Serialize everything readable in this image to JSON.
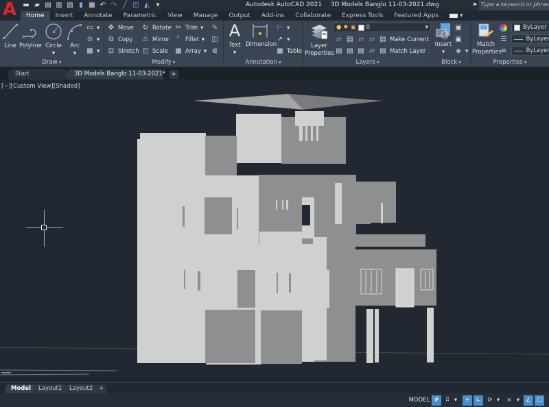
{
  "app": {
    "name": "Autodesk AutoCAD 2021",
    "file": "3D Models Banglo 11-03-2021.dwg",
    "search_placeholder": "Type a keyword or phrase",
    "accent": "#d8262b"
  },
  "qat": [
    "new-icon",
    "open-icon",
    "save-icon",
    "save-as-icon",
    "publish-icon",
    "share-icon",
    "plot-icon",
    "undo-icon",
    "redo-icon",
    "line-icon",
    "box-icon",
    "workspace-icon",
    "customize-icon"
  ],
  "ribbon_tabs": [
    "Home",
    "Insert",
    "Annotate",
    "Parametric",
    "View",
    "Manage",
    "Output",
    "Add-ins",
    "Collaborate",
    "Express Tools",
    "Featured Apps"
  ],
  "panels": {
    "draw": {
      "label": "Draw",
      "line": "Line",
      "polyline": "Polyline",
      "circle": "Circle",
      "arc": "Arc"
    },
    "modify": {
      "label": "Modify",
      "move": "Move",
      "rotate": "Rotate",
      "trim": "Trim",
      "copy": "Copy",
      "mirror": "Mirror",
      "fillet": "Fillet",
      "stretch": "Stretch",
      "scale": "Scale",
      "array": "Array"
    },
    "annotation": {
      "label": "Annotation",
      "text": "Text",
      "dimension": "Dimension",
      "table": "Table"
    },
    "layers": {
      "label": "Layers",
      "layer_properties_1": "Layer",
      "layer_properties_2": "Properties",
      "current_layer": "0",
      "make_current": "Make Current",
      "match_layer": "Match Layer"
    },
    "block": {
      "label": "Block",
      "insert": "Insert"
    },
    "properties": {
      "label": "Properties",
      "match_1": "Match",
      "match_2": "Properties",
      "color": "ByLayer",
      "linetype": "ByLayer",
      "lineweight": "ByLayer"
    }
  },
  "doc_tabs": {
    "start": "Start",
    "current": "3D Models Banglo 11-03-2021*",
    "close": "✕",
    "add": "+"
  },
  "viewport": {
    "label": "[−][Custom View][Shaded]"
  },
  "layout_tabs": [
    "Model",
    "Layout1",
    "Layout2"
  ],
  "layout_add": "+",
  "status": {
    "model": "MODEL"
  }
}
